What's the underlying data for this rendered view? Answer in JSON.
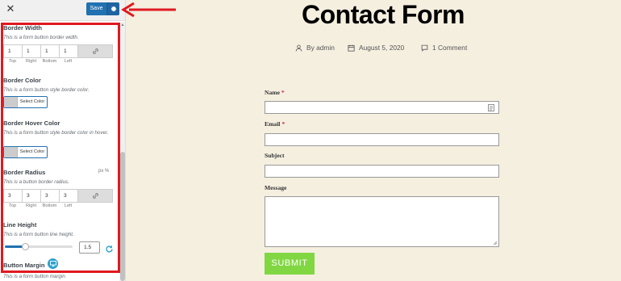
{
  "sidebar": {
    "save_label": "Save",
    "border_width": {
      "title": "Border Width",
      "desc": "This is a form button border width.",
      "values": [
        "1",
        "1",
        "1",
        "1"
      ],
      "labels": [
        "Top",
        "Right",
        "Bottom",
        "Left"
      ]
    },
    "border_color": {
      "title": "Border Color",
      "desc": "This is a form button style border color.",
      "button": "Select Color"
    },
    "border_hover_color": {
      "title": "Border Hover Color",
      "desc": "This is a form button style border color in hover.",
      "button": "Select Color"
    },
    "border_radius": {
      "title": "Border Radius",
      "desc": "This is a button border radius.",
      "unit_switch": "px %",
      "values": [
        "3",
        "3",
        "3",
        "3"
      ],
      "labels": [
        "Top",
        "Right",
        "Bottom",
        "Left"
      ]
    },
    "line_height": {
      "title": "Line Height",
      "desc": "This is a form button line height.",
      "value": "1.5",
      "slider_fraction": 0.3
    },
    "button_margin": {
      "title": "Button Margin",
      "desc": "This is a form button margin."
    }
  },
  "page": {
    "title": "Contact Form",
    "author": "By admin",
    "date": "August 5, 2020",
    "comments": "1 Comment",
    "fields": {
      "name": "Name",
      "email": "Email",
      "subject": "Subject",
      "message": "Message",
      "required_mark": "*"
    },
    "submit_label": "SUBMIT"
  },
  "colors": {
    "accent": "#2271b1",
    "highlight": "#e0191f",
    "submit_bg": "#81d742",
    "page_bg": "#f5efe0"
  }
}
